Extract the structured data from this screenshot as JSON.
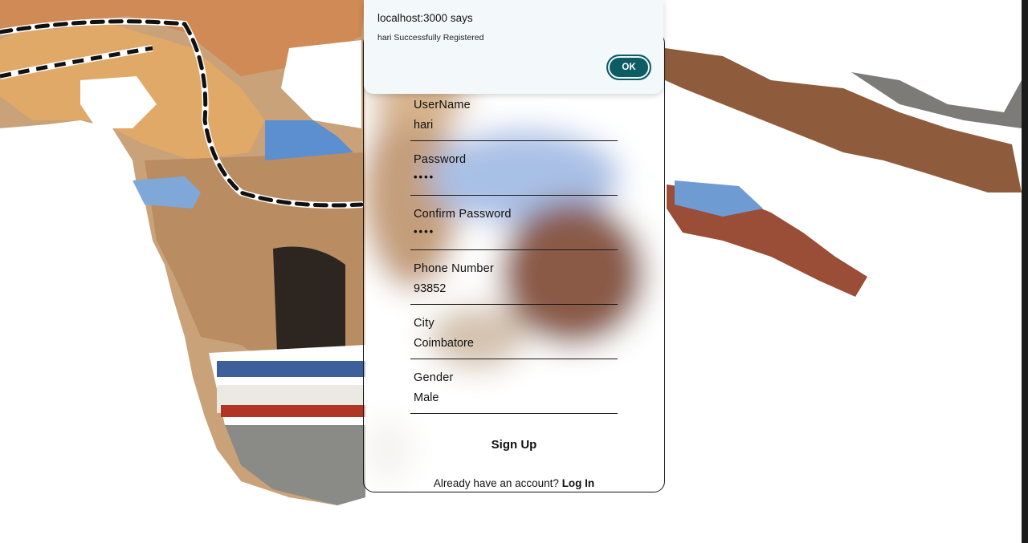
{
  "alert": {
    "title": "localhost:3000 says",
    "message": "hari Successfully Registered",
    "ok_label": "OK"
  },
  "form": {
    "fields": [
      {
        "label": "UserName",
        "value": "hari",
        "type": "text"
      },
      {
        "label": "Password",
        "value": "••••",
        "type": "password"
      },
      {
        "label": "Confirm Password",
        "value": "••••",
        "type": "password"
      },
      {
        "label": "Phone Number",
        "value": "93852",
        "type": "text"
      },
      {
        "label": "City",
        "value": "Coimbatore",
        "type": "text"
      },
      {
        "label": "Gender",
        "value": "Male",
        "type": "text"
      }
    ],
    "submit_label": "Sign Up",
    "footer_text": "Already have an account?",
    "login_link": "Log In"
  },
  "colors": {
    "ok_button": "#0d5c63",
    "alert_bg": "#f3f9fb"
  }
}
